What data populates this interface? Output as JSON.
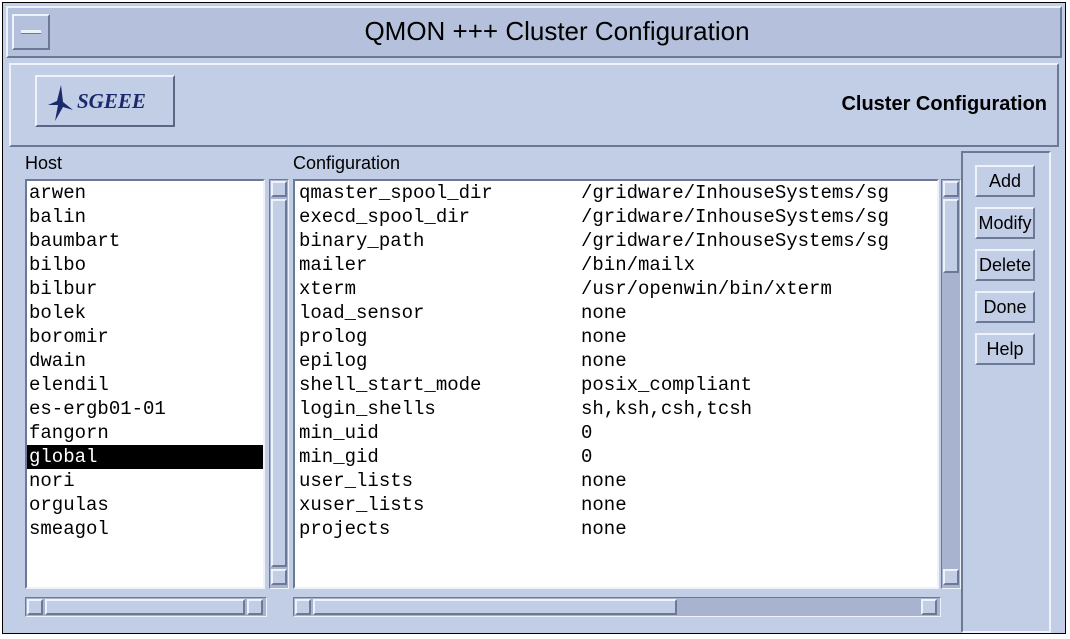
{
  "window": {
    "title": "QMON +++ Cluster Configuration"
  },
  "header": {
    "logo_text": "SGEEE",
    "title": "Cluster Configuration"
  },
  "host": {
    "label": "Host",
    "items": [
      "arwen",
      "balin",
      "baumbart",
      "bilbo",
      "bilbur",
      "bolek",
      "boromir",
      "dwain",
      "elendil",
      "es-ergb01-01",
      "fangorn",
      "global",
      "nori",
      "orgulas",
      "smeagol"
    ],
    "selected": "global"
  },
  "configuration": {
    "label": "Configuration",
    "rows": [
      {
        "key": "qmaster_spool_dir",
        "value": "/gridware/InhouseSystems/sg"
      },
      {
        "key": "execd_spool_dir",
        "value": "/gridware/InhouseSystems/sg"
      },
      {
        "key": "binary_path",
        "value": "/gridware/InhouseSystems/sg"
      },
      {
        "key": "mailer",
        "value": "/bin/mailx"
      },
      {
        "key": "xterm",
        "value": "/usr/openwin/bin/xterm"
      },
      {
        "key": "load_sensor",
        "value": "none"
      },
      {
        "key": "prolog",
        "value": "none"
      },
      {
        "key": "epilog",
        "value": "none"
      },
      {
        "key": "shell_start_mode",
        "value": "posix_compliant"
      },
      {
        "key": "login_shells",
        "value": "sh,ksh,csh,tcsh"
      },
      {
        "key": "min_uid",
        "value": "0"
      },
      {
        "key": "min_gid",
        "value": "0"
      },
      {
        "key": "user_lists",
        "value": "none"
      },
      {
        "key": "xuser_lists",
        "value": "none"
      },
      {
        "key": "projects",
        "value": "none"
      }
    ]
  },
  "buttons": {
    "add": "Add",
    "modify": "Modify",
    "delete": "Delete",
    "done": "Done",
    "help": "Help"
  },
  "scroll": {
    "config_vertical_fraction": 0.2,
    "config_horizontal_fraction": 0.6
  }
}
